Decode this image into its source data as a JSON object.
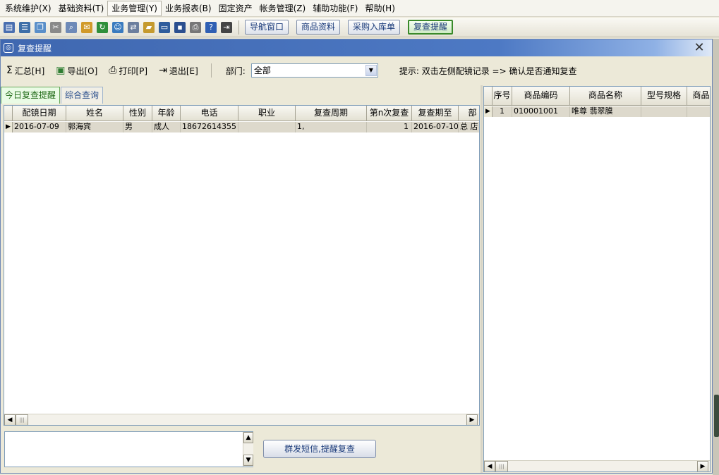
{
  "menu": {
    "items": [
      {
        "label": "系统维护(X)",
        "name": "menu-system"
      },
      {
        "label": "基础资料(T)",
        "name": "menu-basic"
      },
      {
        "label": "业务管理(Y)",
        "name": "menu-business"
      },
      {
        "label": "业务报表(B)",
        "name": "menu-report"
      },
      {
        "label": "固定资产",
        "name": "menu-asset"
      },
      {
        "label": "帐务管理(Z)",
        "name": "menu-account"
      },
      {
        "label": "辅助功能(F)",
        "name": "menu-aux"
      },
      {
        "label": "帮助(H)",
        "name": "menu-help"
      }
    ],
    "active_index": 2
  },
  "toolbar": {
    "icons": [
      {
        "name": "grid-icon",
        "glyph": "▤",
        "color": "#4a6fb0"
      },
      {
        "name": "list-icon",
        "glyph": "☰",
        "color": "#3e6fa8"
      },
      {
        "name": "windows-icon",
        "glyph": "❐",
        "color": "#5a8fc9"
      },
      {
        "name": "tools-icon",
        "glyph": "✂",
        "color": "#8a8a8a"
      },
      {
        "name": "search-doc-icon",
        "glyph": "⌕",
        "color": "#6e8ab8"
      },
      {
        "name": "chat-icon",
        "glyph": "✉",
        "color": "#d19a2a"
      },
      {
        "name": "refresh-icon",
        "glyph": "↻",
        "color": "#2f8f3a"
      },
      {
        "name": "users-icon",
        "glyph": "☺",
        "color": "#3a7bbf"
      },
      {
        "name": "transfer-icon",
        "glyph": "⇄",
        "color": "#6c7f9e"
      },
      {
        "name": "folder-icon",
        "glyph": "▰",
        "color": "#c59a2e"
      },
      {
        "name": "monitor-icon",
        "glyph": "▭",
        "color": "#2e5c9c"
      },
      {
        "name": "save-icon",
        "glyph": "▪",
        "color": "#2b4f8f"
      },
      {
        "name": "print-icon",
        "glyph": "⎙",
        "color": "#777777"
      },
      {
        "name": "help-icon",
        "glyph": "?",
        "color": "#2f5fb3"
      },
      {
        "name": "exit-icon",
        "glyph": "⇥",
        "color": "#444444"
      }
    ],
    "buttons": [
      {
        "label": "导航窗口",
        "name": "nav-window-button"
      },
      {
        "label": "商品资料",
        "name": "product-info-button"
      },
      {
        "label": "采购入库单",
        "name": "purchase-order-button"
      },
      {
        "label": "复查提醒",
        "name": "recheck-reminder-button"
      }
    ],
    "active_button": 3
  },
  "window": {
    "title": "复查提醒",
    "close_glyph": "✕",
    "icon_glyph": "◎"
  },
  "actions": {
    "sum": {
      "icon": "Σ",
      "label": "汇总[H]"
    },
    "export": {
      "icon": "▣",
      "label": "导出[O]"
    },
    "print": {
      "icon": "⎙",
      "label": "打印[P]"
    },
    "exit": {
      "icon": "⇥",
      "label": "退出[E]"
    }
  },
  "department": {
    "label": "部门:",
    "value": "全部",
    "arrow": "▼"
  },
  "hint": "提示: 双击左侧配镜记录 => 确认是否通知复查",
  "tabs": [
    {
      "label": "今日复查提醒",
      "name": "tab-today-reminder"
    },
    {
      "label": "综合查询",
      "name": "tab-comprehensive-query"
    }
  ],
  "left_grid": {
    "columns": [
      "配镜日期",
      "姓名",
      "性别",
      "年龄",
      "电话",
      "职业",
      "复查周期",
      "第n次复查",
      "复查期至",
      "部"
    ],
    "rows": [
      {
        "indicator": "▶",
        "cells": [
          "2016-07-09",
          "郭海宾",
          "男",
          "成人",
          "18672614355",
          "",
          "1,",
          "1",
          "2016-07-10",
          "总  店"
        ]
      }
    ]
  },
  "right_grid": {
    "columns": [
      "序号",
      "商品编码",
      "商品名称",
      "型号规格",
      "商品"
    ],
    "rows": [
      {
        "indicator": "▶",
        "cells": [
          "1",
          "010001001",
          "唯尊 翡翠膜",
          "",
          ""
        ]
      }
    ]
  },
  "scroll": {
    "left": "◀",
    "right": "▶",
    "up": "▲",
    "down": "▼",
    "grip": "|||"
  },
  "sms_button": "群发短信,提醒复查"
}
